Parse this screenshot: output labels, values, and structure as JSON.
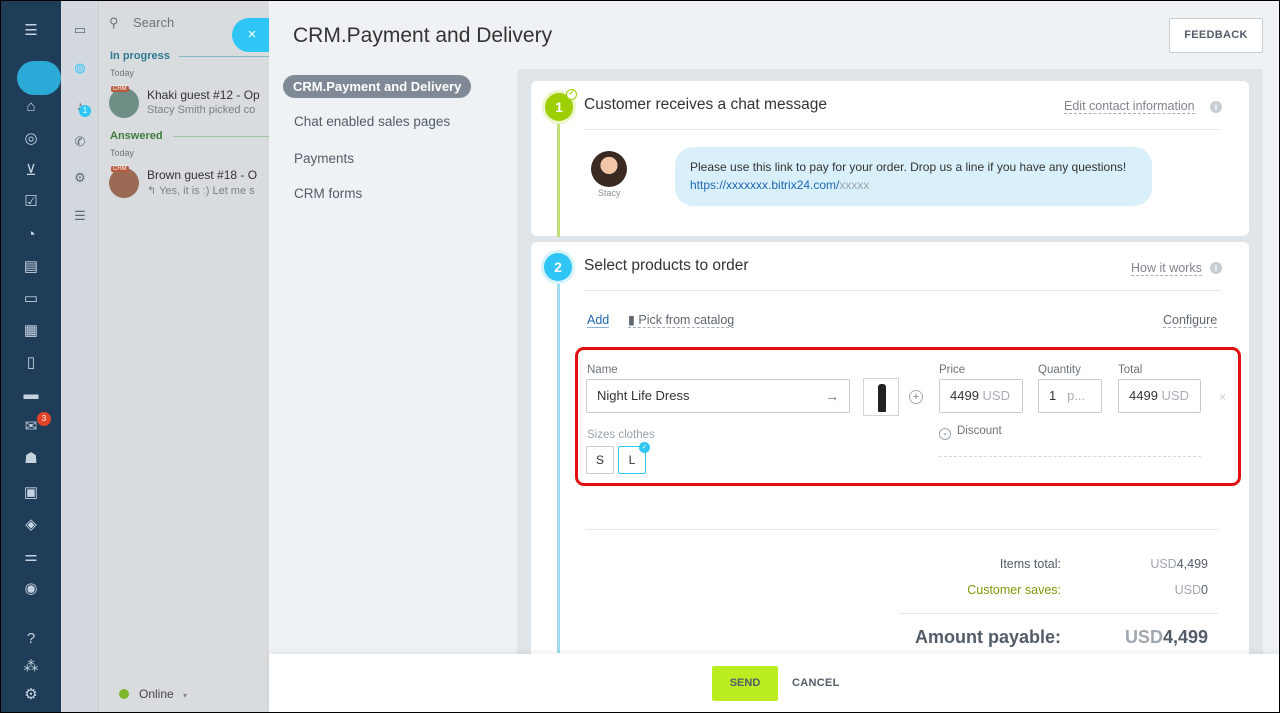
{
  "chatlist": {
    "search_placeholder": "Search",
    "in_progress": "In progress",
    "answered": "Answered",
    "today": "Today",
    "crm_tag": "CRM",
    "chats": [
      {
        "name": "Khaki guest #12 - Op",
        "preview": "Stacy Smith picked co"
      },
      {
        "name": "Brown guest #18 - O",
        "preview": "↰ Yes, it is :) Let me s"
      }
    ],
    "status": "Online"
  },
  "leftnav": {
    "mail_badge": "3",
    "chat_badge": "1"
  },
  "panel": {
    "title": "CRM.Payment and Delivery",
    "feedback": "FEEDBACK",
    "close_icon": "×"
  },
  "menu": {
    "items": [
      {
        "label": "CRM.Payment and Delivery"
      },
      {
        "label": "Chat enabled sales pages"
      },
      {
        "label": "Payments"
      },
      {
        "label": "CRM forms"
      }
    ]
  },
  "step1": {
    "number": "1",
    "title": "Customer receives a chat message",
    "link": "Edit contact information",
    "sender": "Stacy",
    "message": "Please use this link to pay for your order. Drop us a line if you have any questions!",
    "url_main": "https://xxxxxxx.bitrix24.com/",
    "url_tail": "xxxxx"
  },
  "step2": {
    "number": "2",
    "title": "Select products to order",
    "link": "How it works",
    "add": "Add",
    "pick_catalog": "Pick from catalog",
    "configure": "Configure"
  },
  "product": {
    "name_label": "Name",
    "name_value": "Night Life Dress",
    "price_label": "Price",
    "price_value": "4499",
    "price_unit": "USD",
    "quantity_label": "Quantity",
    "quantity_value": "1",
    "quantity_unit": "p...",
    "total_label": "Total",
    "total_value": "4499",
    "total_unit": "USD",
    "sizes_label": "Sizes clothes",
    "sizes": [
      "S",
      "L"
    ],
    "selected_size": "L",
    "discount": "Discount"
  },
  "totals": {
    "items_total_label": "Items total:",
    "items_total_currency": "USD",
    "items_total_value": "4,499",
    "saves_label": "Customer saves:",
    "saves_currency": "USD",
    "saves_value": "0",
    "amount_label": "Amount payable:",
    "amount_currency": "USD",
    "amount_value": "4,499"
  },
  "footer": {
    "send": "SEND",
    "cancel": "CANCEL"
  },
  "colors": {
    "accent": "#2fc6f6",
    "send": "#bbed21",
    "highlight": "#e10f0f",
    "step1": "#9dcf00"
  }
}
